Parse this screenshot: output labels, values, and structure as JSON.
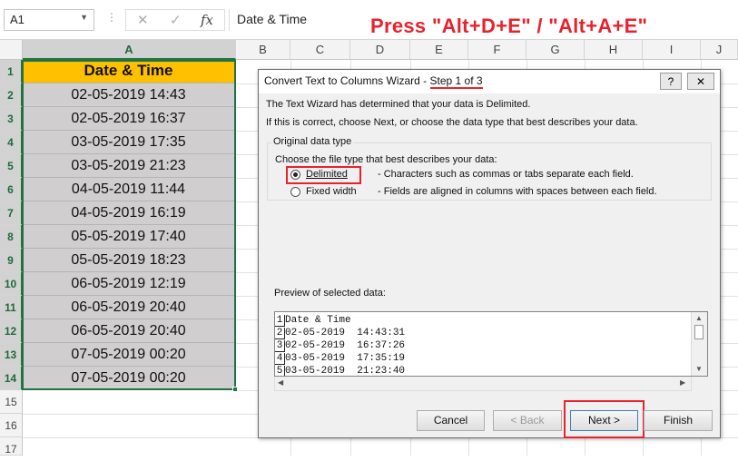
{
  "formula_bar": {
    "name_box": "A1",
    "dots": "⋮",
    "cancel_glyph": "✕",
    "enter_glyph": "✓",
    "fx_glyph": "fx",
    "formula_value": "Date & Time",
    "annotation": "Press \"Alt+D+E\" / \"Alt+A+E\""
  },
  "columns": [
    "A",
    "B",
    "C",
    "D",
    "E",
    "F",
    "G",
    "H",
    "I",
    "J"
  ],
  "rows": [
    "1",
    "2",
    "3",
    "4",
    "5",
    "6",
    "7",
    "8",
    "9",
    "10",
    "11",
    "12",
    "13",
    "14",
    "15",
    "16",
    "17"
  ],
  "cells": {
    "header": "Date & Time",
    "values": [
      "02-05-2019 14:43",
      "02-05-2019 16:37",
      "03-05-2019 17:35",
      "03-05-2019 21:23",
      "04-05-2019 11:44",
      "04-05-2019 16:19",
      "05-05-2019 17:40",
      "05-05-2019 18:23",
      "06-05-2019 12:19",
      "06-05-2019 20:40",
      "06-05-2019 20:40",
      "07-05-2019 00:20",
      "07-05-2019 00:20"
    ]
  },
  "dialog": {
    "title_prefix": "Convert Text to Columns Wizard - ",
    "title_step": "Step 1 of 3",
    "help_glyph": "?",
    "close_glyph": "✕",
    "line1": "The Text Wizard has determined that your data is Delimited.",
    "line2": "If this is correct, choose Next, or choose the data type that best describes your data.",
    "group_label": "Original data type",
    "choose_label": "Choose the file type that best describes your data:",
    "option_delimited": "Delimited",
    "desc_delimited": "- Characters such as commas or tabs separate each field.",
    "option_fixed": "Fixed width",
    "desc_fixed": "- Fields are aligned in columns with spaces between each field.",
    "preview_label": "Preview of selected data:",
    "preview_lines": [
      {
        "num": "1",
        "text": "Date & Time"
      },
      {
        "num": "2",
        "text": "02-05-2019  14:43:31"
      },
      {
        "num": "3",
        "text": "02-05-2019  16:37:26"
      },
      {
        "num": "4",
        "text": "03-05-2019  17:35:19"
      },
      {
        "num": "5",
        "text": "03-05-2019  21:23:40"
      }
    ],
    "buttons": {
      "cancel": "Cancel",
      "back": "< Back",
      "next": "Next >",
      "finish": "Finish"
    }
  },
  "colors": {
    "accent_red": "#e8222d",
    "header_fill": "#ffc000",
    "data_fill": "#d0cece",
    "excel_green": "#217346"
  }
}
